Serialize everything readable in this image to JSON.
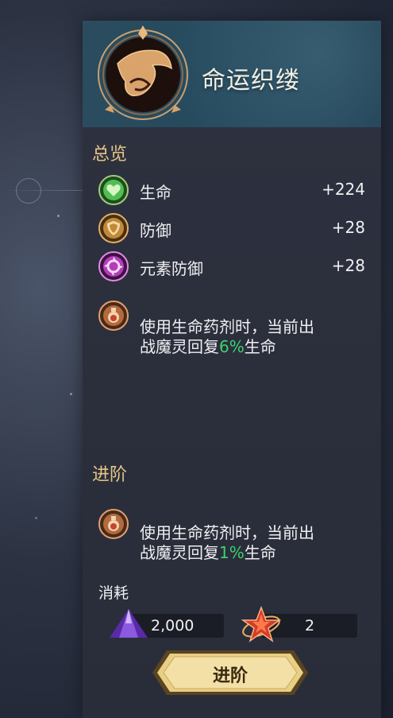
{
  "header": {
    "title": "命运织缕"
  },
  "overview": {
    "title": "总览",
    "stats": [
      {
        "label": "生命",
        "value": "+224",
        "icon": "heart-icon",
        "color": "#4fbf52"
      },
      {
        "label": "防御",
        "value": "+28",
        "icon": "shield-icon",
        "color": "#c08a3a"
      },
      {
        "label": "元素防御",
        "value": "+28",
        "icon": "element-swirl-icon",
        "color": "#b03fb6"
      }
    ],
    "effect": {
      "text_a": "使用生命药剂时，当前出",
      "text_b": "战魔灵回复",
      "percent": "6%",
      "text_c": "生命",
      "icon": "potion-icon"
    }
  },
  "advance": {
    "title": "进阶",
    "effect": {
      "text_a": "使用生命药剂时，当前出",
      "text_b": "战魔灵回复",
      "percent": "1%",
      "text_c": "生命",
      "icon": "potion-icon"
    }
  },
  "cost": {
    "label": "消耗",
    "items": [
      {
        "icon": "purple-crystal-icon",
        "amount": "2,000"
      },
      {
        "icon": "red-star-icon",
        "amount": "2"
      }
    ]
  },
  "button": {
    "label": "进阶"
  },
  "colors": {
    "accent_gold": "#e6c488",
    "highlight_green": "#3dd26c"
  }
}
